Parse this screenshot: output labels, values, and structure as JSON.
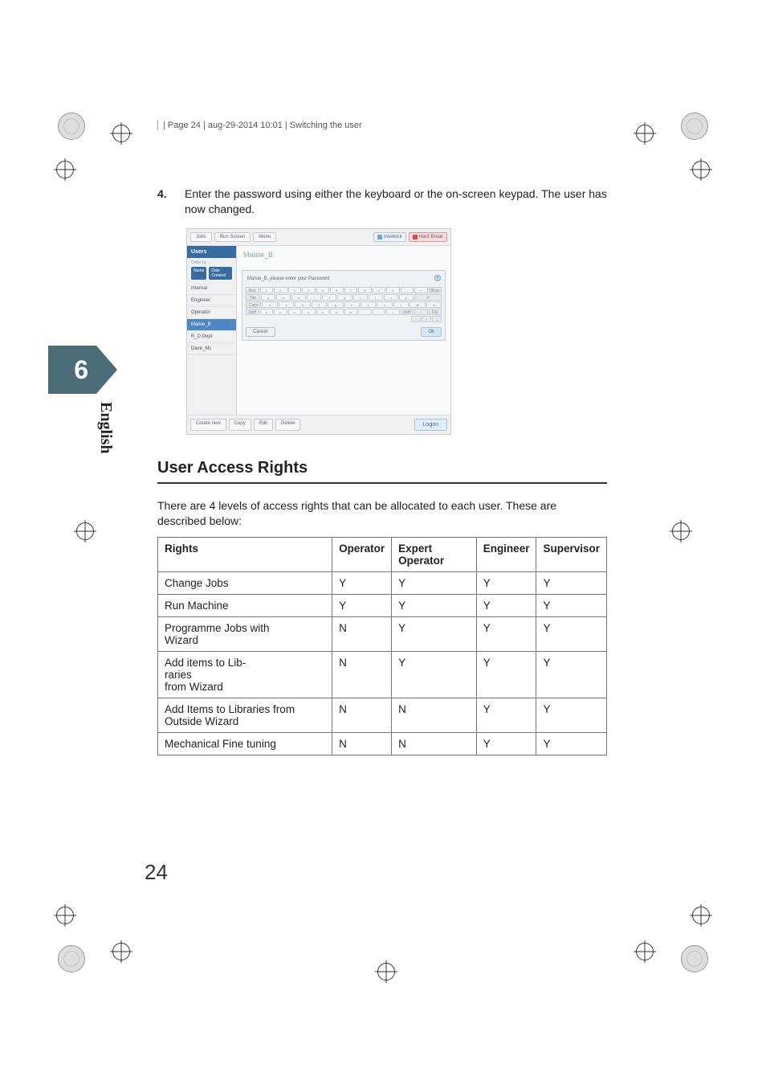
{
  "header": {
    "running_head": "| Page 24 | aug-29-2014 10:01 | Switching the user"
  },
  "step": {
    "number": "4.",
    "text": "Enter the password using either the keyboard or the on-screen keypad. The user has now changed."
  },
  "screenshot": {
    "top_tabs": {
      "jobs": "Jobs",
      "run_screen": "Run Screen",
      "menu": "Menu"
    },
    "indicators": {
      "interlock": "Interlock",
      "hard_break": "Hard Break"
    },
    "side_title": "Users",
    "side_order_label": "Order by",
    "side_chip_name": "Name",
    "side_chip_date": "Date Created",
    "users": [
      "Internal",
      "Engineer",
      "Operator",
      "Maisie_B",
      "R_D Dept",
      "Dave_Mc"
    ],
    "main_title": "Maisie_B",
    "modal_title": "Maisie_B, please enter your Password",
    "help": "?",
    "keys": {
      "esc": "Esc",
      "tab": "Tab",
      "caps": "Caps",
      "shift": "Shift",
      "bksp": "Bksp",
      "del": "Del",
      "row2": [
        "q",
        "w",
        "e",
        "r",
        "t",
        "y",
        "u",
        "i",
        "o",
        "p"
      ],
      "row3": [
        "a",
        "s",
        "d",
        "f",
        "g",
        "h",
        "j",
        "k",
        "l"
      ],
      "row4": [
        "z",
        "x",
        "c",
        "v",
        "b",
        "n",
        "m"
      ],
      "arrows": {
        "up": "↑",
        "down": "↓",
        "left": "←",
        "right": "→"
      }
    },
    "modal_cancel": "Cancel",
    "modal_ok": "Ok",
    "bottom": {
      "create_new": "Create new",
      "copy": "Copy",
      "edit": "Edit",
      "delete": "Delete",
      "logon": "Logon"
    }
  },
  "chapter": {
    "number": "6",
    "language": "English"
  },
  "section": {
    "title": "User Access Rights",
    "intro": "There are 4 levels of access rights that can be allocated to each user. These are described below:"
  },
  "table": {
    "headers": [
      "Rights",
      "Operator",
      "Expert Operator",
      "Engineer",
      "Supervisor"
    ],
    "rows": [
      {
        "r": "Change Jobs",
        "c": [
          "Y",
          "Y",
          "Y",
          "Y"
        ]
      },
      {
        "r": "Run Machine",
        "c": [
          "Y",
          "Y",
          "Y",
          "Y"
        ]
      },
      {
        "r": "Programme Jobs with\nWizard",
        "c": [
          "N",
          "Y",
          "Y",
          "Y"
        ]
      },
      {
        "r": "Add items to Lib-\nraries\nfrom Wizard",
        "c": [
          "N",
          "Y",
          "Y",
          "Y"
        ]
      },
      {
        "r": "Add Items to Libraries from Outside Wizard",
        "c": [
          "N",
          "N",
          "Y",
          "Y"
        ]
      },
      {
        "r": "Mechanical Fine tuning",
        "c": [
          "N",
          "N",
          "Y",
          "Y"
        ]
      }
    ]
  },
  "page_number": "24"
}
